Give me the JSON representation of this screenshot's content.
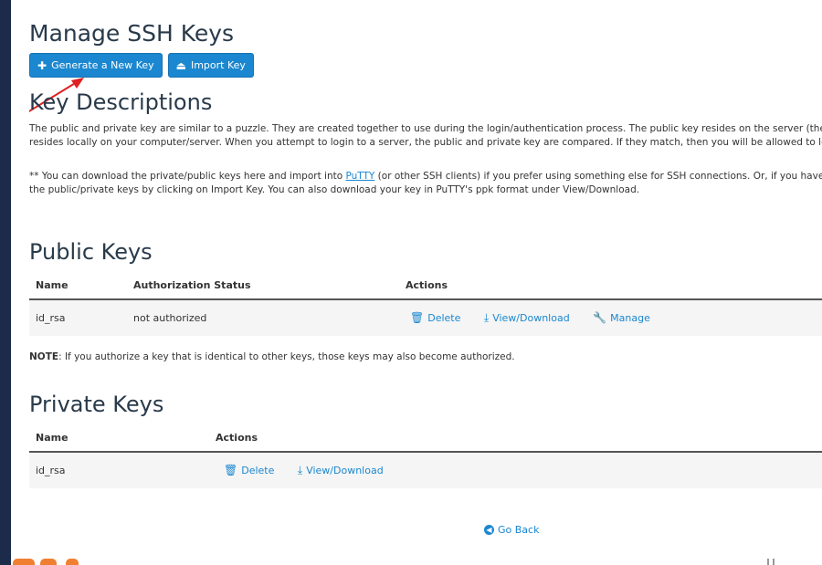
{
  "page": {
    "title": "Manage SSH Keys"
  },
  "buttons": {
    "generate_label": "Generate a New Key",
    "import_label": "Import Key"
  },
  "descriptions": {
    "title": "Key Descriptions",
    "para1_line1": "The public and private key are similar to a puzzle. They are created together to use during the login/authentication process. The public key resides on the server (the rer",
    "para1_line2": "resides locally on your computer/server. When you attempt to login to a server, the public and private key are compared. If they match, then you will be allowed to login",
    "para2_line1_pre": "** You can download the private/public keys here and import into ",
    "para2_link": "PuTTY",
    "para2_line1_post": " (or other SSH clients) if you prefer using something else for SSH connections. Or, if you have be",
    "para2_line2": "the public/private keys by clicking on Import Key. You can also download your key in PuTTY's ppk format under View/Download."
  },
  "public_keys": {
    "title": "Public Keys",
    "headers": [
      "Name",
      "Authorization Status",
      "Actions"
    ],
    "rows": [
      {
        "name": "id_rsa",
        "status": "not authorized"
      }
    ],
    "actions": {
      "delete": "Delete",
      "view_download": "View/Download",
      "manage": "Manage"
    }
  },
  "note": {
    "label": "NOTE",
    "text": ": If you authorize a key that is identical to other keys, those keys may also become authorized."
  },
  "private_keys": {
    "title": "Private Keys",
    "headers": [
      "Name",
      "Actions"
    ],
    "rows": [
      {
        "name": "id_rsa"
      }
    ],
    "actions": {
      "delete": "Delete",
      "view_download": "View/Download"
    }
  },
  "go_back": "Go Back",
  "colors": {
    "accent": "#1b87d0",
    "sidebar": "#1c2b4a",
    "arrow": "#e02020",
    "logo": "#f07f32"
  },
  "icons": {
    "generate": "plus-icon",
    "import": "import-icon",
    "delete": "trash-icon",
    "download": "download-icon",
    "manage": "wrench-icon",
    "go_back": "circle-arrow-left-icon"
  }
}
